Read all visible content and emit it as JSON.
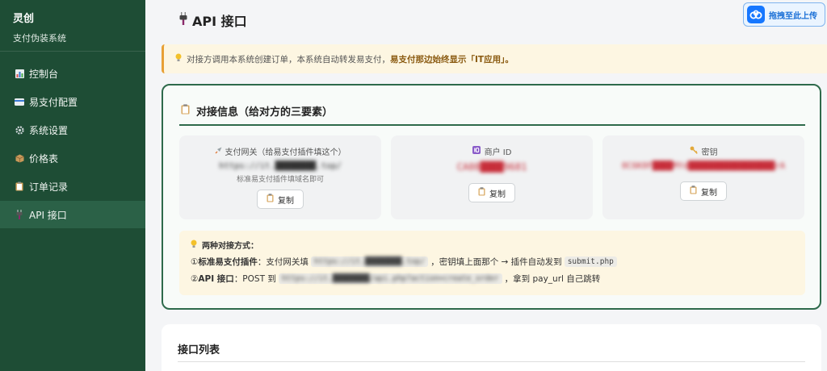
{
  "sidebar": {
    "brand_title": "灵创",
    "brand_subtitle": "支付伪装系统",
    "items": [
      {
        "label": "控制台",
        "icon": "chart-icon"
      },
      {
        "label": "易支付配置",
        "icon": "card-icon"
      },
      {
        "label": "系统设置",
        "icon": "gear-icon"
      },
      {
        "label": "价格表",
        "icon": "package-icon"
      },
      {
        "label": "订单记录",
        "icon": "clipboard-icon"
      },
      {
        "label": "API 接口",
        "icon": "plug-icon",
        "active": true
      }
    ]
  },
  "header": {
    "title": "API 接口",
    "upload_button": "拖拽至此上传"
  },
  "notice": {
    "text": "对接方调用本系统创建订单，本系统自动转发易支付，",
    "emphasis": "易支付那边始终显示「IT应用」。"
  },
  "info_card": {
    "title": "对接信息（给对方的三要素）",
    "tiles": [
      {
        "label": "支付网关（给易支付插件填这个）",
        "value": "https://it.████████.top/",
        "hint": "标准易支付插件填域名即可",
        "copy": "复制"
      },
      {
        "label": "商户 ID",
        "value": "CA08████9681",
        "copy": "复制"
      },
      {
        "label": "密钥",
        "value": "0C6K0F████MYd█████████████████rA",
        "copy": "复制"
      }
    ]
  },
  "ways": {
    "title": "两种对接方式：",
    "line1_prefix": "① ",
    "line1_bold": "标准易支付插件",
    "line1_text": "：支付网关填",
    "line1_code": "https://it.████████.top/",
    "line1_mid": "，密钥填上面那个 → 插件自动发到",
    "line1_code2": "submit.php",
    "line2_prefix": "② ",
    "line2_bold": "API 接口",
    "line2_text": "：POST 到",
    "line2_code": "https://it.████████/api.php?action=create_order",
    "line2_tail": "，拿到 pay_url 自己跳转"
  },
  "list_card": {
    "title": "接口列表"
  },
  "colors": {
    "sidebar_bg": "#1e4d35",
    "accent_green": "#2e6a4b",
    "secret_red": "#c72e3a",
    "notice_bg": "#fdf6e2"
  }
}
